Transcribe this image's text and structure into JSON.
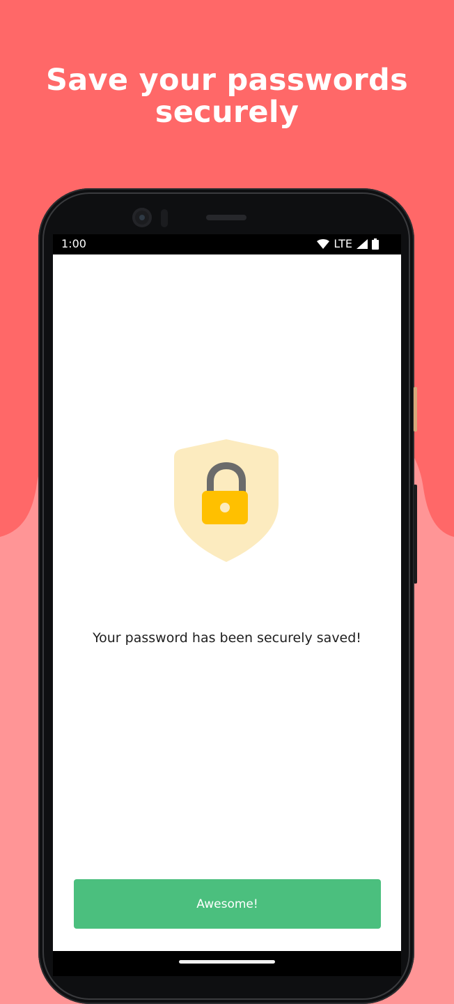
{
  "promo": {
    "headline_line1": "Save your passwords",
    "headline_line2": "securely"
  },
  "status_bar": {
    "time": "1:00",
    "network": "LTE",
    "icons": [
      "wifi-icon",
      "cellular-signal-icon",
      "battery-icon"
    ]
  },
  "content": {
    "illustration": "shield-lock-icon",
    "message": "Your password has been securely saved!"
  },
  "actions": {
    "primary_label": "Awesome!"
  },
  "colors": {
    "background_top": "#ff6868",
    "background_bottom": "#ff9596",
    "button": "#4bbf7e",
    "shield": "#fcebbf",
    "lock_body": "#ffc000",
    "lock_shackle": "#6b6b6b"
  }
}
